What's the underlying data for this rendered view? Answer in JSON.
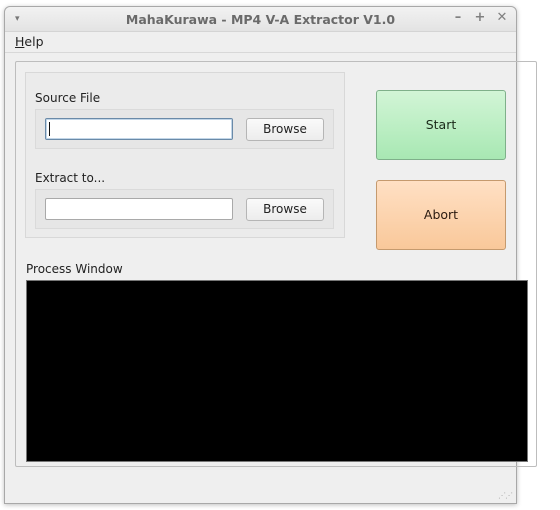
{
  "window": {
    "title": "MahaKurawa - MP4 V-A Extractor V1.0",
    "controls": {
      "menu": "▾",
      "minimize": "–",
      "maximize": "+",
      "close": "✕"
    }
  },
  "menubar": {
    "items": [
      {
        "label": "Help",
        "mnemonic": "H",
        "rest": "elp"
      }
    ]
  },
  "source": {
    "label": "Source File",
    "value": "",
    "browse_label": "Browse"
  },
  "destination": {
    "label": "Extract to...",
    "value": "",
    "browse_label": "Browse"
  },
  "actions": {
    "start_label": "Start",
    "abort_label": "Abort",
    "start_color": "#b5ecbe",
    "abort_color": "#fcd3ab"
  },
  "process": {
    "label": "Process Window",
    "output": ""
  }
}
